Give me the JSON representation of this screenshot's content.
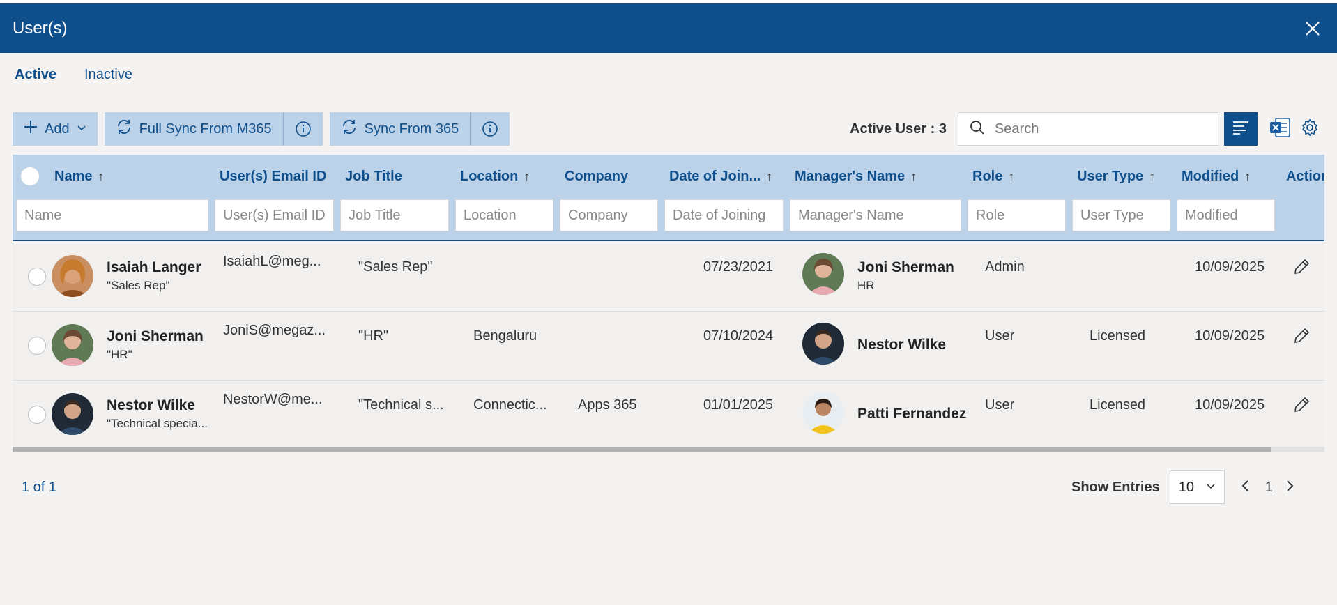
{
  "window": {
    "title": "User(s)"
  },
  "tabs": [
    {
      "label": "Active"
    },
    {
      "label": "Inactive"
    }
  ],
  "toolbar": {
    "add_label": "Add",
    "full_sync_label": "Full Sync From M365",
    "sync_label": "Sync From 365",
    "active_user_label": "Active User : 3",
    "search_placeholder": "Search"
  },
  "columns": [
    {
      "label": "Name",
      "sort": "↑",
      "filter_placeholder": "Name"
    },
    {
      "label": "User(s) Email ID",
      "sort": "",
      "filter_placeholder": "User(s) Email ID"
    },
    {
      "label": "Job Title",
      "sort": "",
      "filter_placeholder": "Job Title"
    },
    {
      "label": "Location",
      "sort": "↑",
      "filter_placeholder": "Location"
    },
    {
      "label": "Company",
      "sort": "",
      "filter_placeholder": "Company"
    },
    {
      "label": "Date of Join...",
      "sort": "↑",
      "filter_placeholder": "Date of Joining"
    },
    {
      "label": "Manager's Name",
      "sort": "↑",
      "filter_placeholder": "Manager's Name"
    },
    {
      "label": "Role",
      "sort": "↑",
      "filter_placeholder": "Role"
    },
    {
      "label": "User Type",
      "sort": "↑",
      "filter_placeholder": "User Type"
    },
    {
      "label": "Modified",
      "sort": "↑",
      "filter_placeholder": "Modified"
    },
    {
      "label": "Action",
      "sort": ""
    }
  ],
  "rows": [
    {
      "name": "Isaiah Langer",
      "subtitle": "\"Sales Rep\"",
      "email": "IsaiahL@meg...",
      "job_title": "\"Sales Rep\"",
      "location": "",
      "company": "",
      "date_of_joining": "07/23/2021",
      "manager_name": "Joni Sherman",
      "manager_sub": "HR",
      "role": "Admin",
      "user_type": "",
      "modified": "10/09/2025"
    },
    {
      "name": "Joni Sherman",
      "subtitle": "\"HR\"",
      "email": "JoniS@megaz...",
      "job_title": "\"HR\"",
      "location": "Bengaluru",
      "company": "",
      "date_of_joining": "07/10/2024",
      "manager_name": "Nestor Wilke",
      "manager_sub": "",
      "role": "User",
      "user_type": "Licensed",
      "modified": "10/09/2025"
    },
    {
      "name": "Nestor Wilke",
      "subtitle": "\"Technical specia...",
      "email": "NestorW@me...",
      "job_title": "\"Technical s...",
      "location": "Connectic...",
      "company": "Apps 365",
      "date_of_joining": "01/01/2025",
      "manager_name": "Patti Fernandez",
      "manager_sub": "",
      "role": "User",
      "user_type": "Licensed",
      "modified": "10/09/2025"
    }
  ],
  "footer": {
    "page_info": "1 of 1",
    "show_entries_label": "Show Entries",
    "entries_value": "10",
    "current_page": "1"
  },
  "colors": {
    "primary": "#0f4f8c",
    "header_bg": "#bcd2e8",
    "page_bg": "#f4f3f2"
  }
}
